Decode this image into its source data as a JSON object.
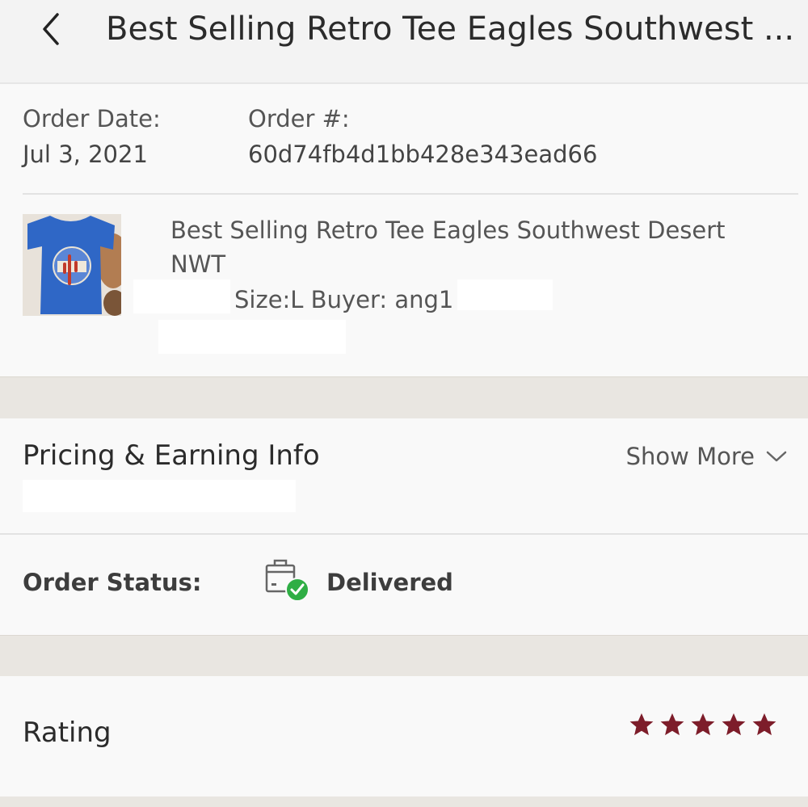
{
  "header": {
    "title": "Best Selling Retro Tee Eagles Southwest ...",
    "back_icon": "chevron-left-icon"
  },
  "order": {
    "date_label": "Order Date:",
    "date_value": "Jul 3, 2021",
    "number_label": "Order #:",
    "number_value": "60d74fb4d1bb428e343ead66"
  },
  "item": {
    "title": "Best Selling Retro Tee Eagles Southwest Desert NWT",
    "meta": "Size:L  Buyer: ang1"
  },
  "pricing": {
    "title": "Pricing & Earning Info",
    "show_more": "Show More",
    "chevron_icon": "chevron-down-icon"
  },
  "status": {
    "label": "Order Status:",
    "value": "Delivered",
    "icon": "delivered-box-icon",
    "icon_color": "#2fae45"
  },
  "rating": {
    "label": "Rating",
    "stars_filled": 5,
    "stars_total": 5,
    "star_color": "#7d1d2a"
  }
}
